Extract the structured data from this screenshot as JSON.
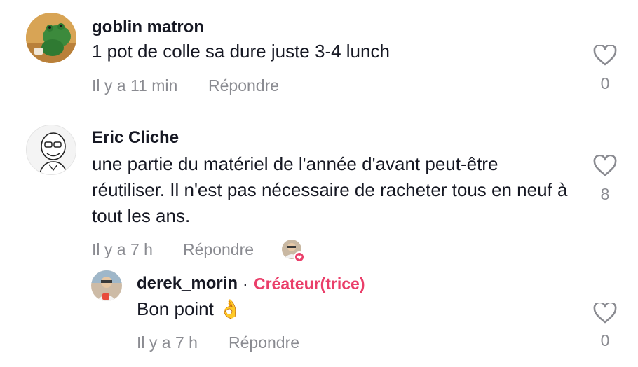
{
  "colors": {
    "creator_badge": "#ea3f6a",
    "muted": "#8a8b91",
    "text": "#161823"
  },
  "comments": [
    {
      "username": "goblin matron",
      "text": "1 pot de colle sa dure juste 3-4 lunch",
      "time": "Il y a 11 min",
      "reply_label": "Répondre",
      "likes": "0",
      "avatar": "frog-avatar-icon"
    },
    {
      "username": "Eric Cliche",
      "text": "une partie du matériel de l'année d'avant peut-être réutiliser. Il n'est pas nécessaire de racheter tous en neuf à tout les ans.",
      "time": "Il y a 7 h",
      "reply_label": "Répondre",
      "likes": "8",
      "avatar": "caricature-avatar-icon",
      "liked_by_creator": "creator-liked-avatar-icon",
      "reply": {
        "username": "derek_morin",
        "separator": "·",
        "badge": "Créateur(trice)",
        "text": "Bon point 👌",
        "time": "Il y a 7 h",
        "reply_label": "Répondre",
        "likes": "0",
        "avatar": "creator-avatar-icon"
      }
    }
  ]
}
